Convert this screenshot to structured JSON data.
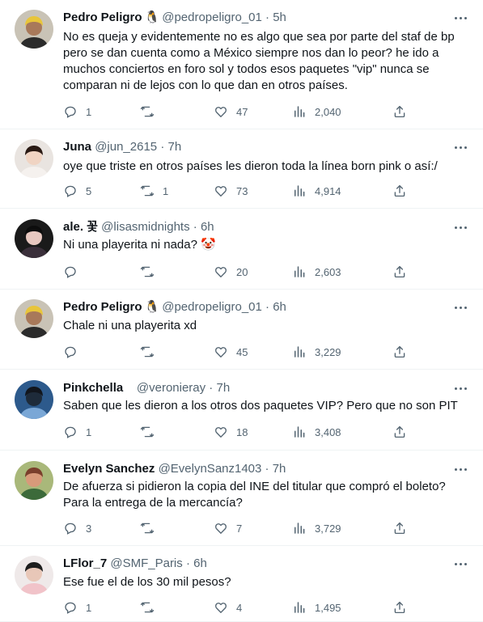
{
  "tweets": [
    {
      "name": "Pedro Peligro",
      "badge": "🐧",
      "handle": "@pedropeligro_01",
      "time": "· 5h",
      "text": [
        "No es queja y evidentemente no es algo que sea por parte del staf de bp",
        "pero se dan cuenta como a México siempre nos dan lo peor?  he ido a",
        "muchos conciertos en foro sol y todos esos paquetes \"vip\" nunca se",
        "comparan ni de lejos con lo que dan en otros países."
      ],
      "replies": "1",
      "retweets": "",
      "likes": "47",
      "views": "2,040"
    },
    {
      "name": "Juna",
      "badge": "",
      "handle": "@jun_2615",
      "time": "· 7h",
      "text": [
        "oye que triste en otros países les dieron toda la línea born pink o así:/"
      ],
      "replies": "5",
      "retweets": "1",
      "likes": "73",
      "views": "4,914"
    },
    {
      "name": "ale. 꽃",
      "badge": "",
      "handle": "@lisasmidnights",
      "time": "· 6h",
      "text": [
        "Ni una playerita ni nada? 🤡"
      ],
      "replies": "",
      "retweets": "",
      "likes": "20",
      "views": "2,603"
    },
    {
      "name": "Pedro Peligro",
      "badge": "🐧",
      "handle": "@pedropeligro_01",
      "time": "· 6h",
      "text": [
        "Chale ni una playerita xd"
      ],
      "replies": "",
      "retweets": "",
      "likes": "45",
      "views": "3,229"
    },
    {
      "name": "Pinkchella",
      "badge": "",
      "handle": "   @veronieray",
      "time": "· 7h",
      "text": [
        "Saben que les dieron a los otros dos paquetes VIP? Pero que no son PIT"
      ],
      "replies": "1",
      "retweets": "",
      "likes": "18",
      "views": "3,408"
    },
    {
      "name": "Evelyn Sanchez",
      "badge": "",
      "handle": "@EvelynSanz1403",
      "time": "· 7h",
      "text": [
        "De afuerza si pidieron la copia del INE del titular que compró el boleto?",
        "Para la entrega de la mercancía?"
      ],
      "replies": "3",
      "retweets": "",
      "likes": "7",
      "views": "3,729"
    },
    {
      "name": "LFlor_7",
      "badge": "",
      "handle": "@SMF_Paris",
      "time": "· 6h",
      "text": [
        "Ese fue el de los 30 mil pesos?"
      ],
      "replies": "1",
      "retweets": "",
      "likes": "4",
      "views": "1,495"
    }
  ],
  "colors": {
    "text": "#0f1419",
    "secondary": "#536471",
    "divider": "#eff3f4"
  },
  "icons": {
    "reply": "reply-icon",
    "retweet": "retweet-icon",
    "like": "heart-icon",
    "views": "views-icon",
    "share": "share-icon",
    "more": "more-icon"
  }
}
